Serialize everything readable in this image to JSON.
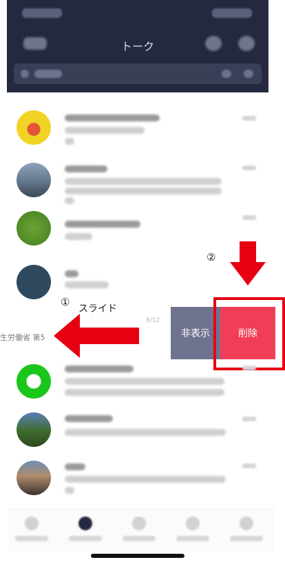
{
  "header": {
    "title": "トーク"
  },
  "list": {
    "section_label": "生労働省 第5",
    "section_date": "8/12"
  },
  "swipe_actions": {
    "hide_label": "非表示",
    "delete_label": "削除"
  },
  "annotations": {
    "step1_number": "①",
    "step1_label": "スライド",
    "step2_number": "②"
  },
  "colors": {
    "header_bg": "#25293f",
    "hide_bg": "#6f7390",
    "delete_bg": "#f23d58",
    "annotation_red": "#e60012"
  },
  "icons": [
    "home-icon",
    "talk-icon",
    "timeline-icon",
    "news-icon",
    "wallet-icon",
    "search-icon",
    "add-friend-icon",
    "settings-icon"
  ]
}
